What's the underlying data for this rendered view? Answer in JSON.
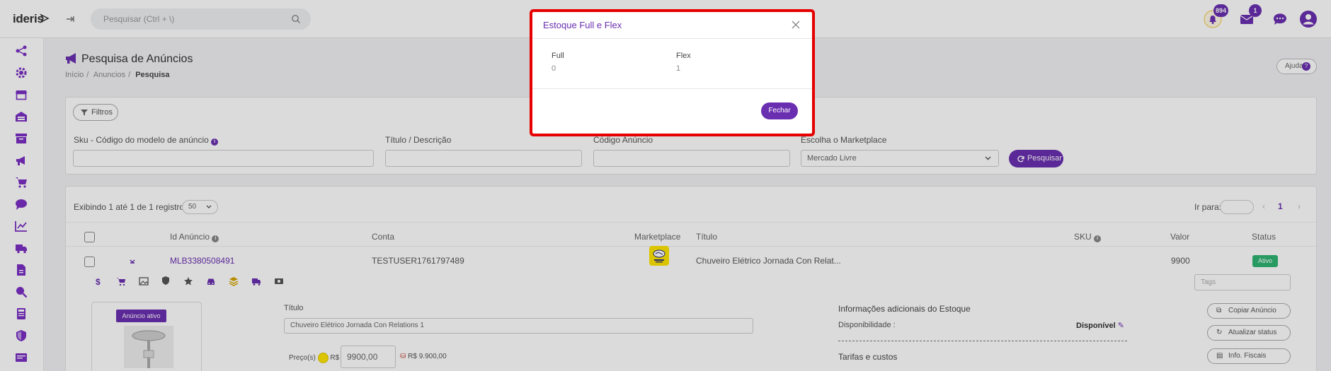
{
  "brand": {
    "logo": "ideris",
    "accent": "#6a2fb0",
    "status_green": "#2fb573",
    "highlight_red": "#e60000"
  },
  "header": {
    "search_placeholder": "Pesquisar (Ctrl + \\)",
    "notifications_count": "894",
    "messages_count": "1"
  },
  "sidebar": {
    "icons": [
      "share-icon",
      "gear-icon",
      "store-icon",
      "warehouse-icon",
      "box-icon",
      "megaphone-icon",
      "cart-icon",
      "chat-icon",
      "chart-icon",
      "truck-icon",
      "document-icon",
      "search-zoom-icon",
      "calculator-icon",
      "shield-icon",
      "invoice-icon"
    ]
  },
  "page": {
    "title": "Pesquisa de Anúncios",
    "breadcrumb": [
      "Início",
      "Anuncios",
      "Pesquisa"
    ],
    "help_label": "Ajuda"
  },
  "filters": {
    "toggle_label": "Filtros",
    "sku_label": "Sku - Código do modelo de anúncio",
    "title_label": "Título / Descrição",
    "code_label": "Código Anúncio",
    "marketplace_label": "Escolha o Marketplace",
    "marketplace_value": "Mercado Livre",
    "search_button": "Pesquisar"
  },
  "results": {
    "showing": "Exibindo 1 até 1 de 1 registros",
    "page_size": "50",
    "goto_label": "Ir para:",
    "current_page": "1",
    "columns": [
      "Id Anúncio",
      "Conta",
      "Marketplace",
      "Título",
      "SKU",
      "Valor",
      "Status"
    ],
    "row": {
      "id": "MLB3380508491",
      "account": "TESTUSER1761797489",
      "marketplace_logo": "mercado livre",
      "title": "Chuveiro Elétrico Jornada Con Relat...",
      "value": "9900",
      "status": "Ativo"
    },
    "tags_placeholder": "Tags"
  },
  "detail": {
    "active_badge": "Anúncio ativo",
    "title_label": "Título",
    "title_value": "Chuveiro Elétrico Jornada Con Relations 1",
    "price_label": "Preço(s)",
    "currency": "R$",
    "price_value": "9900,00",
    "price_display": "R$ 9.900,00",
    "stock_info_title": "Informações adicionais do Estoque",
    "availability_label": "Disponibilidade :",
    "availability_value": "Disponível",
    "fees_title": "Tarifas e custos",
    "actions": [
      "Copiar Anúncio",
      "Atualizar status",
      "Info. Fiscais"
    ]
  },
  "modal": {
    "title": "Estoque Full e Flex",
    "full_label": "Full",
    "full_value": "0",
    "flex_label": "Flex",
    "flex_value": "1",
    "close_button": "Fechar"
  }
}
